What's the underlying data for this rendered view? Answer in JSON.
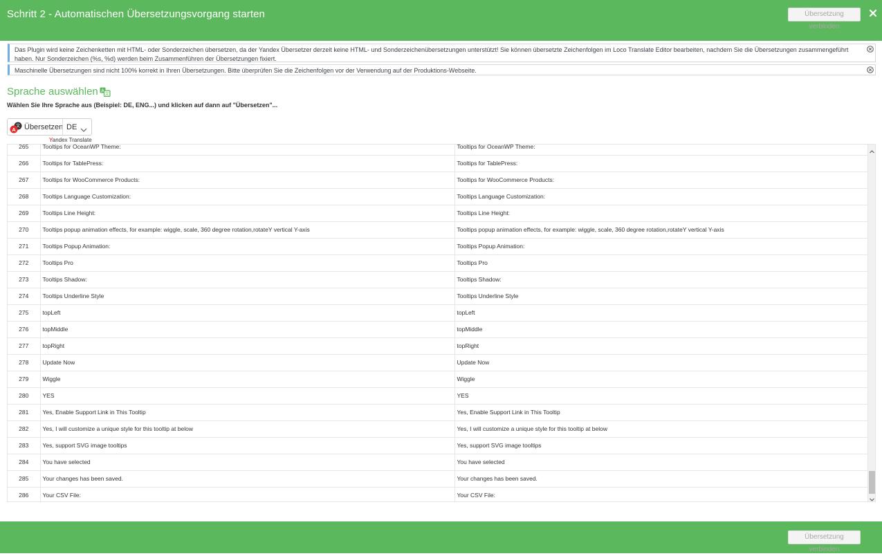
{
  "header": {
    "title": "Schritt 2 - Automatischen Übersetzungsvorgang starten",
    "merge_button_label": "Übersetzung verbinden"
  },
  "notices": [
    {
      "text": "Das Plugin wird keine Zeichenketten mit HTML- oder Sonderzeichen übersetzen, da der Yandex Übersetzer derzeit keine HTML- und Sonderzeichenübersetzungen unterstützt! Sie können übersetzte Zeichenfolgen im Loco Translate Editor bearbeiten, nachdem Sie die Übersetzungen zusammengeführt haben. Nur Sonderzeichen (%s, %d) werden beim Zusammenführen der Übersetzungen fixiert."
    },
    {
      "text": "Maschinelle Übersetzungen sind nicht 100% korrekt in Ihren Übersetzungen. Bitte überprüfen Sie die Zeichenfolgen vor der Verwendung auf der Produktions-Webseite."
    }
  ],
  "language_section": {
    "title": "Sprache auswählen",
    "description": "Wählen Sie Ihre Sprache aus (Beispiel: DE, ENG...) und klicken auf dann auf \"Übersetzen\"...",
    "translate_label": "Übersetzen",
    "selected_language": "DE",
    "credit_y": "Y",
    "credit_rest": "andex Translate"
  },
  "rows": [
    {
      "num": "265",
      "source": "Tooltips for OceanWP Theme:",
      "target": "Tooltips for OceanWP Theme:"
    },
    {
      "num": "266",
      "source": "Tooltips for TablePress:",
      "target": "Tooltips for TablePress:"
    },
    {
      "num": "267",
      "source": "Tooltips for WooCommerce Products:",
      "target": "Tooltips for WooCommerce Products:"
    },
    {
      "num": "268",
      "source": "Tooltips Language Customization:",
      "target": "Tooltips Language Customization:"
    },
    {
      "num": "269",
      "source": "Tooltips Line Height:",
      "target": "Tooltips Line Height:"
    },
    {
      "num": "270",
      "source": "Tooltips popup animation effects, for example: wiggle, scale, 360 degree rotation,rotateY vertical Y-axis",
      "target": "Tooltips popup animation effects, for example: wiggle, scale, 360 degree rotation,rotateY vertical Y-axis"
    },
    {
      "num": "271",
      "source": "Tooltips Popup Animation:",
      "target": "Tooltips Popup Animation:"
    },
    {
      "num": "272",
      "source": "Tooltips Pro",
      "target": "Tooltips Pro"
    },
    {
      "num": "273",
      "source": "Tooltips Shadow:",
      "target": "Tooltips Shadow:"
    },
    {
      "num": "274",
      "source": "Tooltips Underline Style",
      "target": "Tooltips Underline Style"
    },
    {
      "num": "275",
      "source": "topLeft",
      "target": "topLeft"
    },
    {
      "num": "276",
      "source": "topMiddle",
      "target": "topMiddle"
    },
    {
      "num": "277",
      "source": "topRight",
      "target": "topRight"
    },
    {
      "num": "278",
      "source": "Update Now",
      "target": "Update Now"
    },
    {
      "num": "279",
      "source": "Wiggle",
      "target": "Wiggle"
    },
    {
      "num": "280",
      "source": "YES",
      "target": "YES"
    },
    {
      "num": "281",
      "source": "Yes, Enable Support Link in This Tooltip",
      "target": "Yes, Enable Support Link in This Tooltip"
    },
    {
      "num": "282",
      "source": "Yes, I will customize a unique style for this tooltip at below",
      "target": "Yes, I will customize a unique style for this tooltip at below"
    },
    {
      "num": "283",
      "source": "Yes, support SVG image tooltips",
      "target": "Yes, support SVG image tooltips"
    },
    {
      "num": "284",
      "source": "You have selected",
      "target": "You have selected"
    },
    {
      "num": "285",
      "source": "Your changes has been saved.",
      "target": "Your changes has been saved."
    },
    {
      "num": "286",
      "source": "Your CSV File:",
      "target": "Your CSV File:"
    }
  ],
  "colors": {
    "brand_green": "#5cb85c",
    "notice_accent": "#72aee6"
  },
  "icons": [
    "close-icon",
    "dismiss-icon",
    "translate-language-icon",
    "yandex-translate-icon",
    "chevron-down-icon",
    "scroll-up-arrow-icon",
    "scroll-down-arrow-icon"
  ]
}
